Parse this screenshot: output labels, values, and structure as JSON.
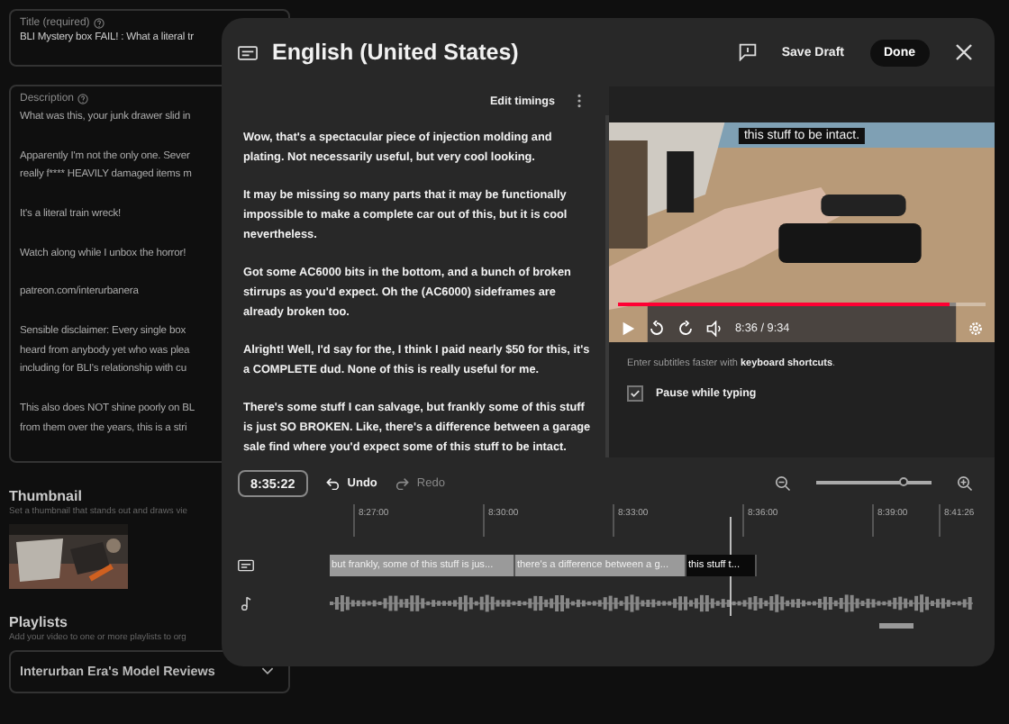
{
  "page": {
    "title_field": {
      "label": "Title (required)",
      "value": "BLI Mystery box FAIL! : What a literal tr"
    },
    "description_field": {
      "label": "Description",
      "paragraphs": [
        [
          "What was this, your junk drawer slid in"
        ],
        [
          "Apparently I'm not the only one. Sever",
          "really f**** HEAVILY damaged items m"
        ],
        [
          "It's a literal train wreck!"
        ],
        [
          "Watch along while I unbox the horror!"
        ],
        [
          "patreon.com/interurbanera"
        ],
        [
          "Sensible disclaimer: Every single box",
          "heard from anybody yet who was plea",
          "including for BLI's relationship with cu"
        ],
        [
          "This also does NOT shine poorly on BL",
          "from them over the years, this is a stri"
        ]
      ]
    },
    "thumbnail": {
      "heading": "Thumbnail",
      "hint": "Set a thumbnail that stands out and draws vie",
      "kind": "picture"
    },
    "playlists": {
      "heading": "Playlists",
      "hint": "Add your video to one or more playlists to org",
      "value": "Interurban Era's Model Reviews"
    }
  },
  "dialog": {
    "title": "English (United States)",
    "save_draft": "Save Draft",
    "done": "Done",
    "edit_timings": "Edit timings",
    "transcript": [
      "Wow, that's a spectacular piece of injection molding and plating. Not necessarily useful, but very cool looking.",
      "It may be missing so many parts that it may be functionally impossible to make a complete car out of this, but it is cool nevertheless.",
      "Got some AC6000 bits in the bottom, and a bunch of broken stirrups as you'd expect. Oh the (AC6000) sideframes are already broken too.",
      "Alright! Well, I'd say for the, I think I paid nearly $50 for this, it's a COMPLETE dud. None of this is really useful for me.",
      "There's some stuff I can salvage, but frankly some of this stuff is just SO BROKEN. Like, there's a difference between a garage sale find where you'd expect some of this stuff to be intact."
    ],
    "player": {
      "caption": "this stuff to be intact.",
      "time": "8:36 / 9:34",
      "level": 0.9
    },
    "shortcuts_hint": "Enter subtitles faster with **keyboard shortcuts**.",
    "pause_while_typing": {
      "label": "Pause while typing",
      "checked": true
    },
    "timeline": {
      "current_time": "8:35:22",
      "undo": {
        "label": "Undo",
        "disabled": false
      },
      "redo": {
        "label": "Redo",
        "disabled": true
      },
      "zoom": {
        "level": 0.75
      },
      "ticks": [
        "8:27:00",
        "8:30:00",
        "8:33:00",
        "8:36:00",
        "8:39:00",
        "8:41:26"
      ],
      "segments": [
        {
          "text": "but frankly, some of this stuff is jus...",
          "selected": false
        },
        {
          "text": "there's a difference between a g...",
          "selected": false
        },
        {
          "text": "this stuff t...",
          "selected": true
        }
      ]
    }
  }
}
